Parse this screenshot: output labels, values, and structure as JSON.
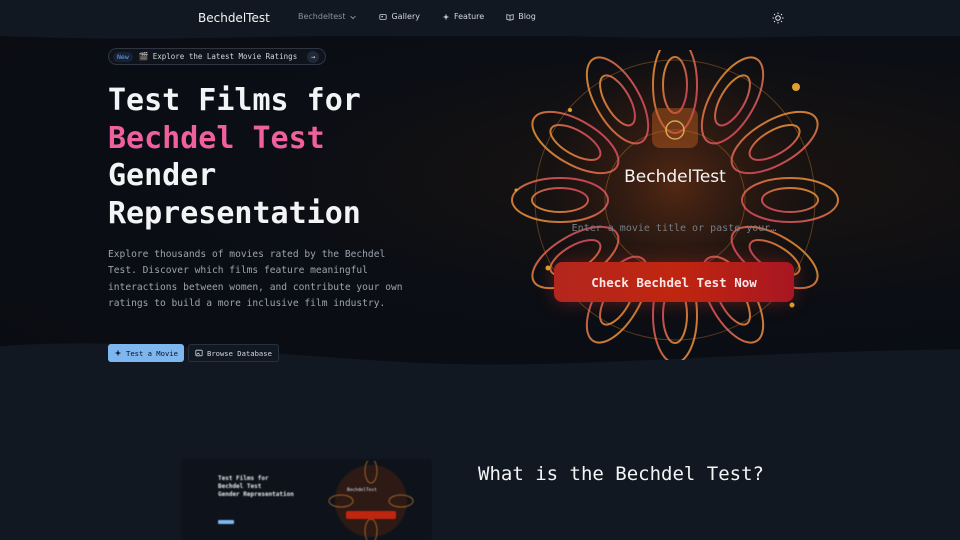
{
  "nav": {
    "brand": "BechdelTest",
    "links": [
      {
        "label": "Bechdeltest",
        "icon": "chevron-down-icon"
      },
      {
        "label": "Gallery",
        "icon": "gallery-icon"
      },
      {
        "label": "Feature",
        "icon": "sparkle-icon"
      },
      {
        "label": "Blog",
        "icon": "book-icon"
      }
    ],
    "theme_icon": "sun-icon"
  },
  "hero": {
    "badge_new": "New",
    "badge_text": "Explore the Latest Movie Ratings",
    "badge_arrow": "→",
    "headline_line1": "Test Films for",
    "headline_highlight": "Bechdel Test",
    "headline_line3": "Gender",
    "headline_line4": "Representation",
    "description": "Explore thousands of movies rated by the Bechdel Test. Discover which films feature meaningful interactions between women, and contribute your own ratings to build a more inclusive film industry.",
    "primary_button": "Test a Movie",
    "secondary_button": "Browse Database"
  },
  "checker": {
    "title": "BechdelTest",
    "input_placeholder": "Enter a movie title or paste your…",
    "button": "Check Bechdel Test Now"
  },
  "preview": {
    "line1": "Test Films for",
    "line2": "Bechdel Test",
    "line3": "Gender Representation",
    "mini_title": "BechdelTest"
  },
  "section2": {
    "title": "What is the Bechdel Test?"
  },
  "colors": {
    "accent_pink": "#f0609e",
    "primary_blue": "#7eb6f0",
    "cta_red": "#c0260f",
    "background": "#0b1018"
  }
}
